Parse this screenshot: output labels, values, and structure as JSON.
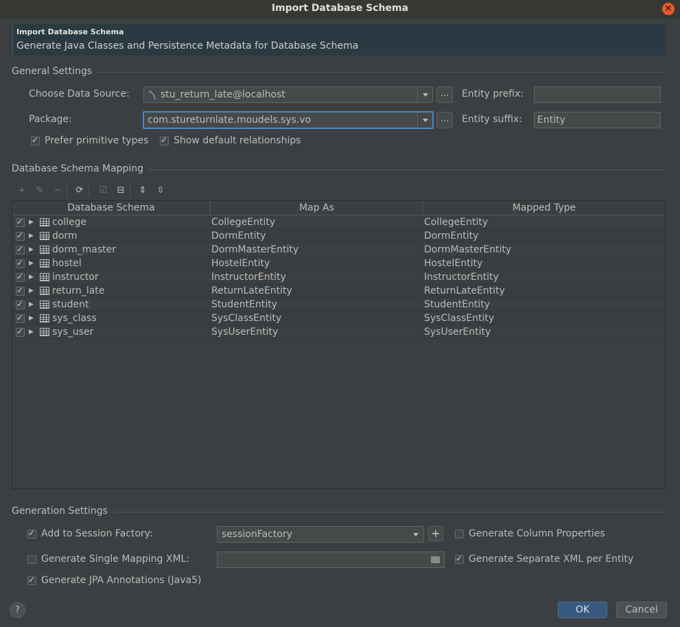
{
  "window": {
    "title": "Import Database Schema"
  },
  "header": {
    "title": "Import Database Schema",
    "subtitle": "Generate Java Classes and Persistence Metadata for Database Schema"
  },
  "general": {
    "section_title": "General Settings",
    "data_source_label": "Choose Data Source:",
    "data_source_value": "stu_return_late@localhost",
    "dots_label": "...",
    "package_label": "Package:",
    "package_value": "com.stureturnlate.moudels.sys.vo",
    "entity_prefix_label": "Entity prefix:",
    "entity_prefix_value": "",
    "entity_suffix_label": "Entity suffix:",
    "entity_suffix_value": "Entity",
    "prefer_primitive_label": "Prefer primitive types",
    "prefer_primitive_checked": true,
    "show_relationships_label": "Show default relationships",
    "show_relationships_checked": true
  },
  "mapping": {
    "section_title": "Database Schema Mapping",
    "columns": [
      "Database Schema",
      "Map As",
      "Mapped Type"
    ],
    "rows": [
      {
        "schema": "college",
        "map_as": "CollegeEntity",
        "mapped_type": "CollegeEntity",
        "checked": true
      },
      {
        "schema": "dorm",
        "map_as": "DormEntity",
        "mapped_type": "DormEntity",
        "checked": true
      },
      {
        "schema": "dorm_master",
        "map_as": "DormMasterEntity",
        "mapped_type": "DormMasterEntity",
        "checked": true
      },
      {
        "schema": "hostel",
        "map_as": "HostelEntity",
        "mapped_type": "HostelEntity",
        "checked": true
      },
      {
        "schema": "instructor",
        "map_as": "InstructorEntity",
        "mapped_type": "InstructorEntity",
        "checked": true
      },
      {
        "schema": "return_late",
        "map_as": "ReturnLateEntity",
        "mapped_type": "ReturnLateEntity",
        "checked": true
      },
      {
        "schema": "student",
        "map_as": "StudentEntity",
        "mapped_type": "StudentEntity",
        "checked": true
      },
      {
        "schema": "sys_class",
        "map_as": "SysClassEntity",
        "mapped_type": "SysClassEntity",
        "checked": true
      },
      {
        "schema": "sys_user",
        "map_as": "SysUserEntity",
        "mapped_type": "SysUserEntity",
        "checked": true
      }
    ]
  },
  "generation": {
    "section_title": "Generation Settings",
    "add_session_factory_label": "Add to Session Factory:",
    "add_session_factory_checked": true,
    "session_factory_value": "sessionFactory",
    "plus_label": "+",
    "generate_column_props_label": "Generate Column Properties",
    "generate_column_props_checked": false,
    "single_mapping_xml_label": "Generate Single Mapping XML:",
    "single_mapping_xml_checked": false,
    "single_mapping_xml_value": "",
    "separate_xml_label": "Generate Separate XML per Entity",
    "separate_xml_checked": true,
    "jpa_annotations_label": "Generate JPA Annotations (Java5)",
    "jpa_annotations_checked": true
  },
  "footer": {
    "help_label": "?",
    "ok_label": "OK",
    "cancel_label": "Cancel"
  },
  "colors": {
    "background": "#3c3f41",
    "header_panel": "#2b3a42",
    "ok_button": "#365880",
    "focus_border": "#4a88c7",
    "close_button": "#e25a2d"
  }
}
